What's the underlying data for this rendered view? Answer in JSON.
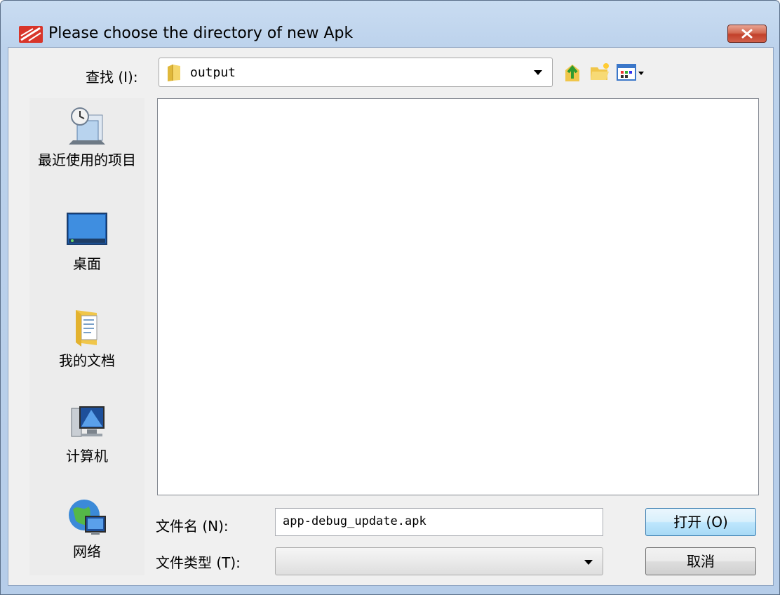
{
  "dialog": {
    "title": "Please choose the directory of new Apk"
  },
  "look_in": {
    "label": "查找 (I):",
    "value": "output"
  },
  "places": [
    {
      "label": "最近使用的项目",
      "icon": "recent-items-icon"
    },
    {
      "label": "桌面",
      "icon": "desktop-icon"
    },
    {
      "label": "我的文档",
      "icon": "documents-folder-icon"
    },
    {
      "label": "计算机",
      "icon": "computer-icon"
    },
    {
      "label": "网络",
      "icon": "network-icon"
    }
  ],
  "file_name": {
    "label": "文件名 (N):",
    "value": "app-debug_update.apk"
  },
  "file_type": {
    "label": "文件类型 (T):",
    "value": ""
  },
  "buttons": {
    "open": "打开 (O)",
    "cancel": "取消"
  },
  "colors": {
    "title_bar": "#c9dcf1",
    "close_button": "#c2402a",
    "dialog_bg": "#f0f0f0",
    "open_button": "#bee6fd"
  }
}
